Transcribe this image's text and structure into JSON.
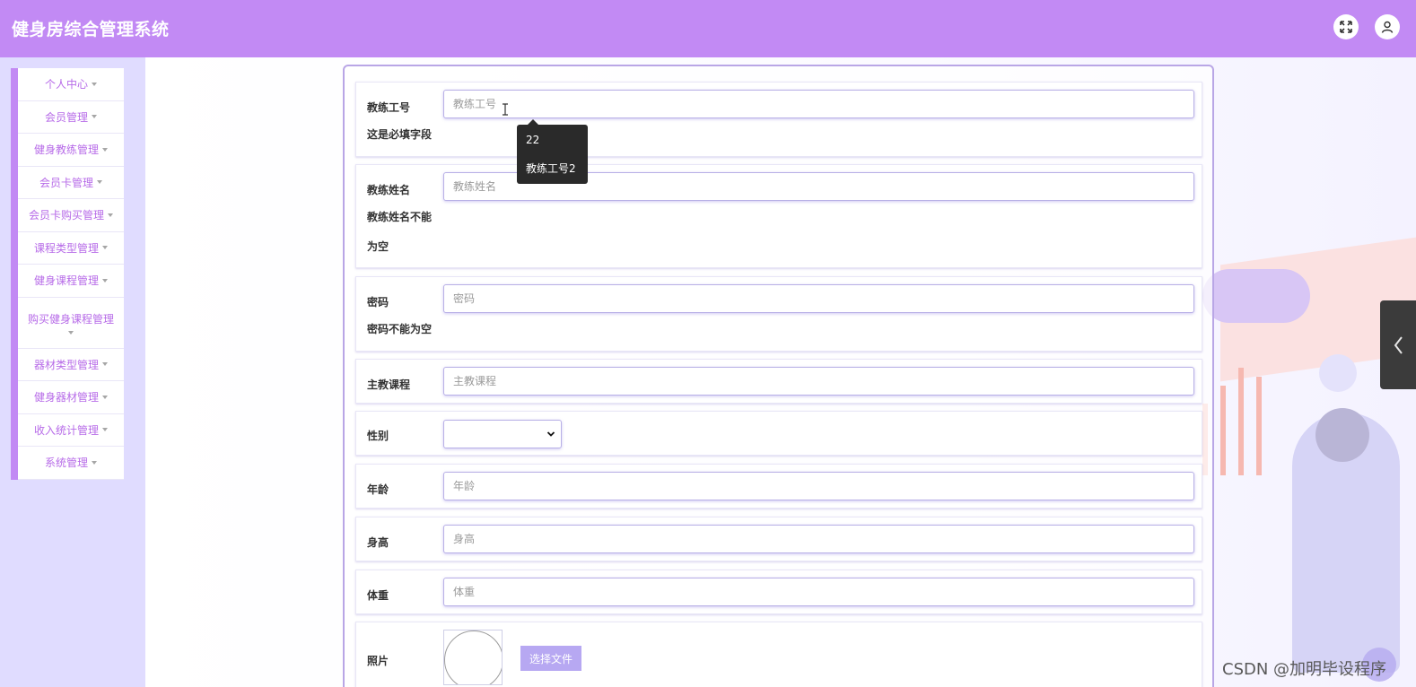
{
  "app": {
    "title": "健身房综合管理系统"
  },
  "header_icons": {
    "fullscreen": "expand-icon",
    "user": "user-icon"
  },
  "sidebar": {
    "items": [
      {
        "label": "个人中心"
      },
      {
        "label": "会员管理"
      },
      {
        "label": "健身教练管理"
      },
      {
        "label": "会员卡管理"
      },
      {
        "label": "会员卡购买管理"
      },
      {
        "label": "课程类型管理"
      },
      {
        "label": "健身课程管理"
      },
      {
        "label": "购买健身课程管理"
      },
      {
        "label": "器材类型管理"
      },
      {
        "label": "健身器材管理"
      },
      {
        "label": "收入统计管理"
      },
      {
        "label": "系统管理"
      }
    ]
  },
  "form": {
    "coach_id": {
      "label": "教练工号",
      "placeholder": "教练工号",
      "hint": "这是必填字段"
    },
    "coach_name": {
      "label": "教练姓名",
      "placeholder": "教练姓名",
      "hint_line1": "教练姓名不能",
      "hint_line2": "为空"
    },
    "password": {
      "label": "密码",
      "placeholder": "密码",
      "hint": "密码不能为空"
    },
    "course": {
      "label": "主教课程",
      "placeholder": "主教课程"
    },
    "gender": {
      "label": "性别",
      "value": ""
    },
    "age": {
      "label": "年龄",
      "placeholder": "年龄"
    },
    "height": {
      "label": "身高",
      "placeholder": "身高"
    },
    "weight": {
      "label": "体重",
      "placeholder": "体重"
    },
    "photo": {
      "label": "照片",
      "button": "选择文件"
    }
  },
  "autocomplete": {
    "items": [
      "22",
      "教练工号2"
    ]
  },
  "watermark": "CSDN @加明毕设程序"
}
